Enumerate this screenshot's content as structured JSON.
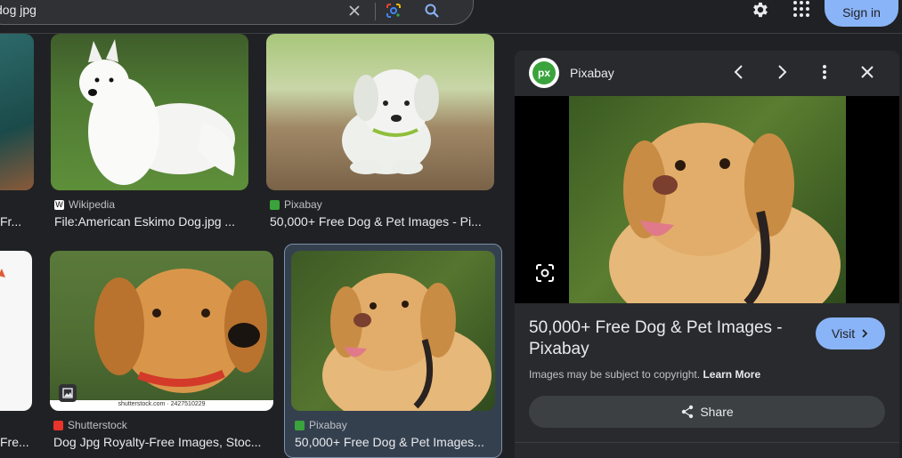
{
  "search": {
    "query": "dog jpg"
  },
  "header": {
    "signin_label": "Sign in"
  },
  "results": [
    {
      "source": "Fr...",
      "title": ""
    },
    {
      "source": "Wikipedia",
      "title": "File:American Eskimo Dog.jpg ..."
    },
    {
      "source": "Pixabay",
      "title": "50,000+ Free Dog & Pet Images - Pi..."
    },
    {
      "source": "",
      "title": "Fr..."
    },
    {
      "source": "Shutterstock",
      "title": "Dog Jpg Royalty-Free Images, Stoc...",
      "watermark": "shutterstock.com · 2427510229"
    },
    {
      "source": "Pixabay",
      "title": "50,000+ Free Dog & Pet Images..."
    }
  ],
  "left_edge": {
    "row1_title": "Fr...",
    "row2_title": "Fre..."
  },
  "panel": {
    "source": "Pixabay",
    "logo_text": "px",
    "title": "50,000+ Free Dog & Pet Images - Pixabay",
    "visit_label": "Visit",
    "copyright_text": "Images may be subject to copyright.",
    "learn_more": "Learn More",
    "share_label": "Share"
  },
  "colors": {
    "accent": "#8ab4f8",
    "background": "#202124",
    "panel": "#292a2d"
  }
}
